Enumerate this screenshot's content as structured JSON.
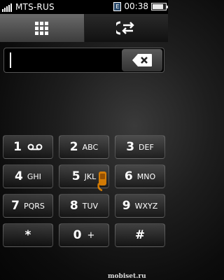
{
  "status_bar": {
    "carrier": "MTS-RUS",
    "time": "00:38",
    "sim_label": "E",
    "battery_level": 0.85
  },
  "tabs": [
    {
      "icon": "dialpad-grid-icon",
      "selected": true
    },
    {
      "icon": "call-log-arrows-icon",
      "selected": false
    }
  ],
  "number_field": {
    "value": ""
  },
  "backspace": {
    "icon": "backspace-x-icon"
  },
  "keypad": [
    {
      "digit": "1",
      "letters": "",
      "icon": "voicemail-icon"
    },
    {
      "digit": "2",
      "letters": "ABC"
    },
    {
      "digit": "3",
      "letters": "DEF"
    },
    {
      "digit": "4",
      "letters": "GHI"
    },
    {
      "digit": "5",
      "letters": "JKL"
    },
    {
      "digit": "6",
      "letters": "MNO"
    },
    {
      "digit": "7",
      "letters": "PQRS"
    },
    {
      "digit": "8",
      "letters": "TUV"
    },
    {
      "digit": "9",
      "letters": "WXYZ"
    },
    {
      "digit": "*",
      "letters": ""
    },
    {
      "digit": "0",
      "letters": "+"
    },
    {
      "digit": "#",
      "letters": ""
    }
  ],
  "watermark": "mobiset.ru",
  "colors": {
    "background": "#1e1e1e",
    "status_bar": "#000000",
    "accent_logo": "#f08a00"
  }
}
